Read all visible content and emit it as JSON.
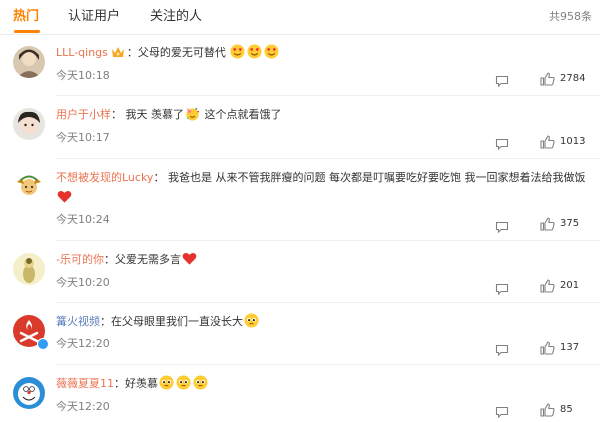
{
  "tabs": {
    "hot": "热门",
    "verified": "认证用户",
    "following": "关注的人",
    "total": "共958条"
  },
  "colors": {
    "accent": "#ff8200",
    "username": "#eb7350",
    "verified_username": "#5d7dbd",
    "meta": "#808080"
  },
  "comments": [
    {
      "user": "LLL-qings",
      "colon": "：",
      "text_parts": [
        "父母的爱无可替代"
      ],
      "emojis": [
        "heart-eyes-emoji",
        "heart-eyes-emoji",
        "heart-eyes-emoji"
      ],
      "time": "今天10:18",
      "likes": "2784"
    },
    {
      "user": "用户于小样",
      "colon": "：",
      "text_parts": [
        "我天 羡慕了",
        "这个点就看饿了"
      ],
      "emojis": [
        "party-emoji"
      ],
      "time": "今天10:17",
      "likes": "1013"
    },
    {
      "user": "不想被发现的Lucky",
      "colon": "：",
      "text_parts": [
        "我爸也是 从来不管我胖瘦的问题 每次都是叮嘱要吃好要吃饱 我一回家想着法给我做饭"
      ],
      "emojis": [
        "red-heart-emoji"
      ],
      "time": "今天10:24",
      "likes": "375"
    },
    {
      "user": "-乐可的你",
      "colon": "：",
      "text_parts": [
        "父爱无需多言"
      ],
      "emojis": [
        "red-heart-emoji"
      ],
      "time": "今天10:20",
      "likes": "201"
    },
    {
      "user": "篝火视频",
      "colon": "：",
      "text_parts": [
        "在父母眼里我们一直没长大"
      ],
      "emojis": [
        "pleading-face-emoji"
      ],
      "time": "今天12:20",
      "likes": "137"
    },
    {
      "user": "薇薇夏夏11",
      "colon": "：",
      "text_parts": [
        "好羡慕"
      ],
      "emojis": [
        "pleading-face-emoji",
        "pleading-face-emoji",
        "pleading-face-emoji"
      ],
      "time": "今天12:20",
      "likes": "85"
    }
  ]
}
